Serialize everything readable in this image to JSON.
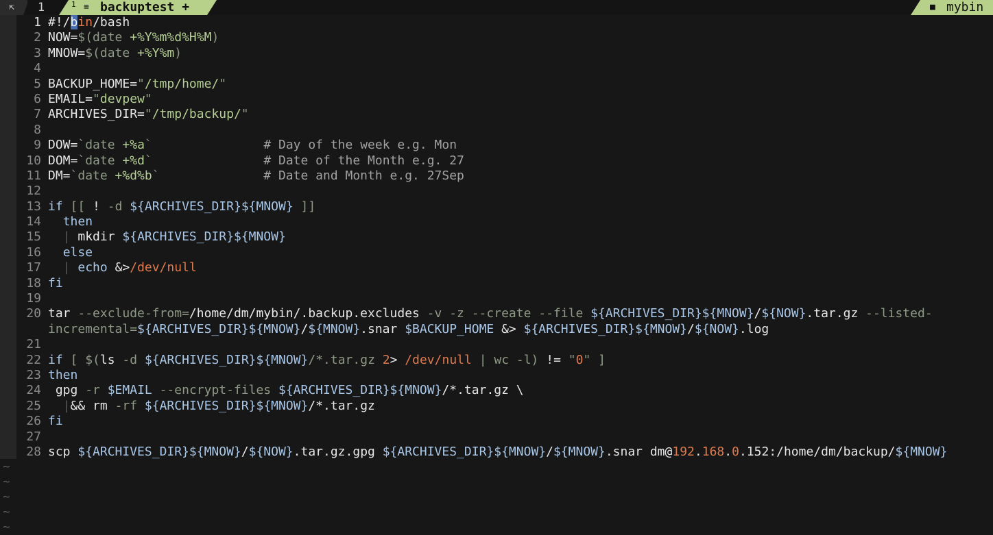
{
  "tabline": {
    "mode_icon": "buffer-icon",
    "tab_count": "1",
    "active_tab": {
      "index": "1",
      "icon": "file-lines-icon",
      "name": "backuptest",
      "modified": "+"
    },
    "right": {
      "icon": "folder-icon",
      "label": "mybin"
    }
  },
  "colors": {
    "background": "#171717",
    "tab_accent": "#b8d18a",
    "line_number": "#8a8a8a",
    "string": "#b5cf95",
    "comment": "#a2a2a2",
    "variable": "#a9c7e8",
    "number": "#e07a4e",
    "cursor": "#4a6faf"
  },
  "editor": {
    "cursor": {
      "line": 1,
      "column": 4,
      "char": "b"
    },
    "lines": [
      {
        "num": "1",
        "segs": [
          [
            "w",
            "#!/"
          ],
          [
            "cursor",
            "b"
          ],
          [
            "o",
            "in"
          ],
          [
            "w",
            "/bash"
          ]
        ]
      },
      {
        "num": "2",
        "segs": [
          [
            "w",
            "NOW="
          ],
          [
            "m",
            "$(date "
          ],
          [
            "g",
            "+%Y%m%d%H%M"
          ],
          [
            "m",
            ")"
          ]
        ]
      },
      {
        "num": "3",
        "segs": [
          [
            "w",
            "MNOW="
          ],
          [
            "m",
            "$(date "
          ],
          [
            "g",
            "+%Y%m"
          ],
          [
            "m",
            ")"
          ]
        ]
      },
      {
        "num": "4",
        "segs": []
      },
      {
        "num": "5",
        "segs": [
          [
            "w",
            "BACKUP_HOME="
          ],
          [
            "m",
            "\""
          ],
          [
            "g",
            "/tmp/home/"
          ],
          [
            "m",
            "\""
          ]
        ]
      },
      {
        "num": "6",
        "segs": [
          [
            "w",
            "EMAIL="
          ],
          [
            "m",
            "\""
          ],
          [
            "g",
            "devpew"
          ],
          [
            "m",
            "\""
          ]
        ]
      },
      {
        "num": "7",
        "segs": [
          [
            "w",
            "ARCHIVES_DIR="
          ],
          [
            "m",
            "\""
          ],
          [
            "g",
            "/tmp/backup/"
          ],
          [
            "m",
            "\""
          ]
        ]
      },
      {
        "num": "8",
        "segs": []
      },
      {
        "num": "9",
        "segs": [
          [
            "w",
            "DOW="
          ],
          [
            "m",
            "`date "
          ],
          [
            "g",
            "+%a"
          ],
          [
            "m",
            "`"
          ],
          [
            "w",
            "               "
          ],
          [
            "c",
            "# Day of the week e.g. Mon"
          ]
        ]
      },
      {
        "num": "10",
        "segs": [
          [
            "w",
            "DOM="
          ],
          [
            "m",
            "`date "
          ],
          [
            "g",
            "+%d"
          ],
          [
            "m",
            "`"
          ],
          [
            "w",
            "               "
          ],
          [
            "c",
            "# Date of the Month e.g. 27"
          ]
        ]
      },
      {
        "num": "11",
        "segs": [
          [
            "w",
            "DM="
          ],
          [
            "m",
            "`date "
          ],
          [
            "g",
            "+%d%b"
          ],
          [
            "m",
            "`"
          ],
          [
            "w",
            "              "
          ],
          [
            "c",
            "# Date and Month e.g. 27Sep"
          ]
        ]
      },
      {
        "num": "12",
        "segs": []
      },
      {
        "num": "13",
        "segs": [
          [
            "k",
            "if"
          ],
          [
            "w",
            " "
          ],
          [
            "m",
            "[["
          ],
          [
            "w",
            " ! "
          ],
          [
            "m",
            "-d"
          ],
          [
            "w",
            " "
          ],
          [
            "v",
            "${ARCHIVES_DIR}${MNOW}"
          ],
          [
            "w",
            " "
          ],
          [
            "m",
            "]]"
          ]
        ]
      },
      {
        "num": "14",
        "segs": [
          [
            "w",
            "  "
          ],
          [
            "k",
            "then"
          ]
        ]
      },
      {
        "num": "15",
        "segs": [
          [
            "w",
            "  "
          ],
          [
            "ind",
            "|"
          ],
          [
            "w",
            " mkdir "
          ],
          [
            "v",
            "${ARCHIVES_DIR}${MNOW}"
          ]
        ]
      },
      {
        "num": "16",
        "segs": [
          [
            "w",
            "  "
          ],
          [
            "k",
            "else"
          ]
        ]
      },
      {
        "num": "17",
        "segs": [
          [
            "w",
            "  "
          ],
          [
            "ind",
            "|"
          ],
          [
            "w",
            " "
          ],
          [
            "k",
            "echo"
          ],
          [
            "w",
            " &>"
          ],
          [
            "o",
            "/dev/null"
          ]
        ]
      },
      {
        "num": "18",
        "segs": [
          [
            "k",
            "fi"
          ]
        ]
      },
      {
        "num": "19",
        "segs": []
      },
      {
        "num": "20",
        "segs": [
          [
            "w",
            "tar "
          ],
          [
            "m",
            "--exclude-from="
          ],
          [
            "w",
            "/home/dm/mybin/.backup.excludes "
          ],
          [
            "m",
            "-v -z --create --file "
          ],
          [
            "v",
            "${ARCHIVES_DIR}${MNOW}"
          ],
          [
            "w",
            "/"
          ],
          [
            "v",
            "${NOW}"
          ],
          [
            "w",
            ".tar.gz "
          ],
          [
            "m",
            "--listed-"
          ]
        ]
      },
      {
        "num": "",
        "segs": [
          [
            "m",
            "incremental="
          ],
          [
            "v",
            "${ARCHIVES_DIR}${MNOW}"
          ],
          [
            "w",
            "/"
          ],
          [
            "v",
            "${MNOW}"
          ],
          [
            "w",
            ".snar "
          ],
          [
            "v",
            "$BACKUP_HOME"
          ],
          [
            "w",
            " &> "
          ],
          [
            "v",
            "${ARCHIVES_DIR}${MNOW}"
          ],
          [
            "w",
            "/"
          ],
          [
            "v",
            "${NOW}"
          ],
          [
            "w",
            ".log"
          ]
        ]
      },
      {
        "num": "21",
        "segs": []
      },
      {
        "num": "22",
        "segs": [
          [
            "k",
            "if"
          ],
          [
            "w",
            " "
          ],
          [
            "m",
            "["
          ],
          [
            "w",
            " "
          ],
          [
            "m",
            "$("
          ],
          [
            "w",
            "ls "
          ],
          [
            "m",
            "-d"
          ],
          [
            "w",
            " "
          ],
          [
            "v",
            "${ARCHIVES_DIR}${MNOW}"
          ],
          [
            "m",
            "/*.tar.gz"
          ],
          [
            "w",
            " "
          ],
          [
            "o",
            "2"
          ],
          [
            "w",
            "> "
          ],
          [
            "o",
            "/dev/null"
          ],
          [
            "w",
            " "
          ],
          [
            "m",
            "| wc -l)"
          ],
          [
            "w",
            " != "
          ],
          [
            "m",
            "\""
          ],
          [
            "o",
            "0"
          ],
          [
            "m",
            "\""
          ],
          [
            "w",
            " "
          ],
          [
            "m",
            "]"
          ]
        ]
      },
      {
        "num": "23",
        "segs": [
          [
            "k",
            "then"
          ]
        ]
      },
      {
        "num": "24",
        "segs": [
          [
            "w",
            " gpg "
          ],
          [
            "m",
            "-r"
          ],
          [
            "w",
            " "
          ],
          [
            "v",
            "$EMAIL"
          ],
          [
            "w",
            " "
          ],
          [
            "m",
            "--encrypt-files"
          ],
          [
            "w",
            " "
          ],
          [
            "v",
            "${ARCHIVES_DIR}${MNOW}"
          ],
          [
            "w",
            "/*.tar.gz \\"
          ]
        ]
      },
      {
        "num": "25",
        "segs": [
          [
            "w",
            "  "
          ],
          [
            "ind",
            "|"
          ],
          [
            "w",
            "&& rm "
          ],
          [
            "m",
            "-rf"
          ],
          [
            "w",
            " "
          ],
          [
            "v",
            "${ARCHIVES_DIR}${MNOW}"
          ],
          [
            "w",
            "/*.tar.gz"
          ]
        ]
      },
      {
        "num": "26",
        "segs": [
          [
            "k",
            "fi"
          ]
        ]
      },
      {
        "num": "27",
        "segs": []
      },
      {
        "num": "28",
        "segs": [
          [
            "w",
            "scp "
          ],
          [
            "v",
            "${ARCHIVES_DIR}${MNOW}"
          ],
          [
            "w",
            "/"
          ],
          [
            "v",
            "${NOW}"
          ],
          [
            "w",
            ".tar.gz.gpg "
          ],
          [
            "v",
            "${ARCHIVES_DIR}${MNOW}"
          ],
          [
            "w",
            "/"
          ],
          [
            "v",
            "${MNOW}"
          ],
          [
            "w",
            ".snar dm@"
          ],
          [
            "o",
            "192"
          ],
          [
            "w",
            "."
          ],
          [
            "o",
            "168"
          ],
          [
            "w",
            "."
          ],
          [
            "o",
            "0"
          ],
          [
            "w",
            ".152:/home/dm/backup/"
          ],
          [
            "v",
            "${MNOW}"
          ]
        ]
      }
    ],
    "tildes": [
      "~",
      "~",
      "~",
      "~",
      "~"
    ]
  }
}
